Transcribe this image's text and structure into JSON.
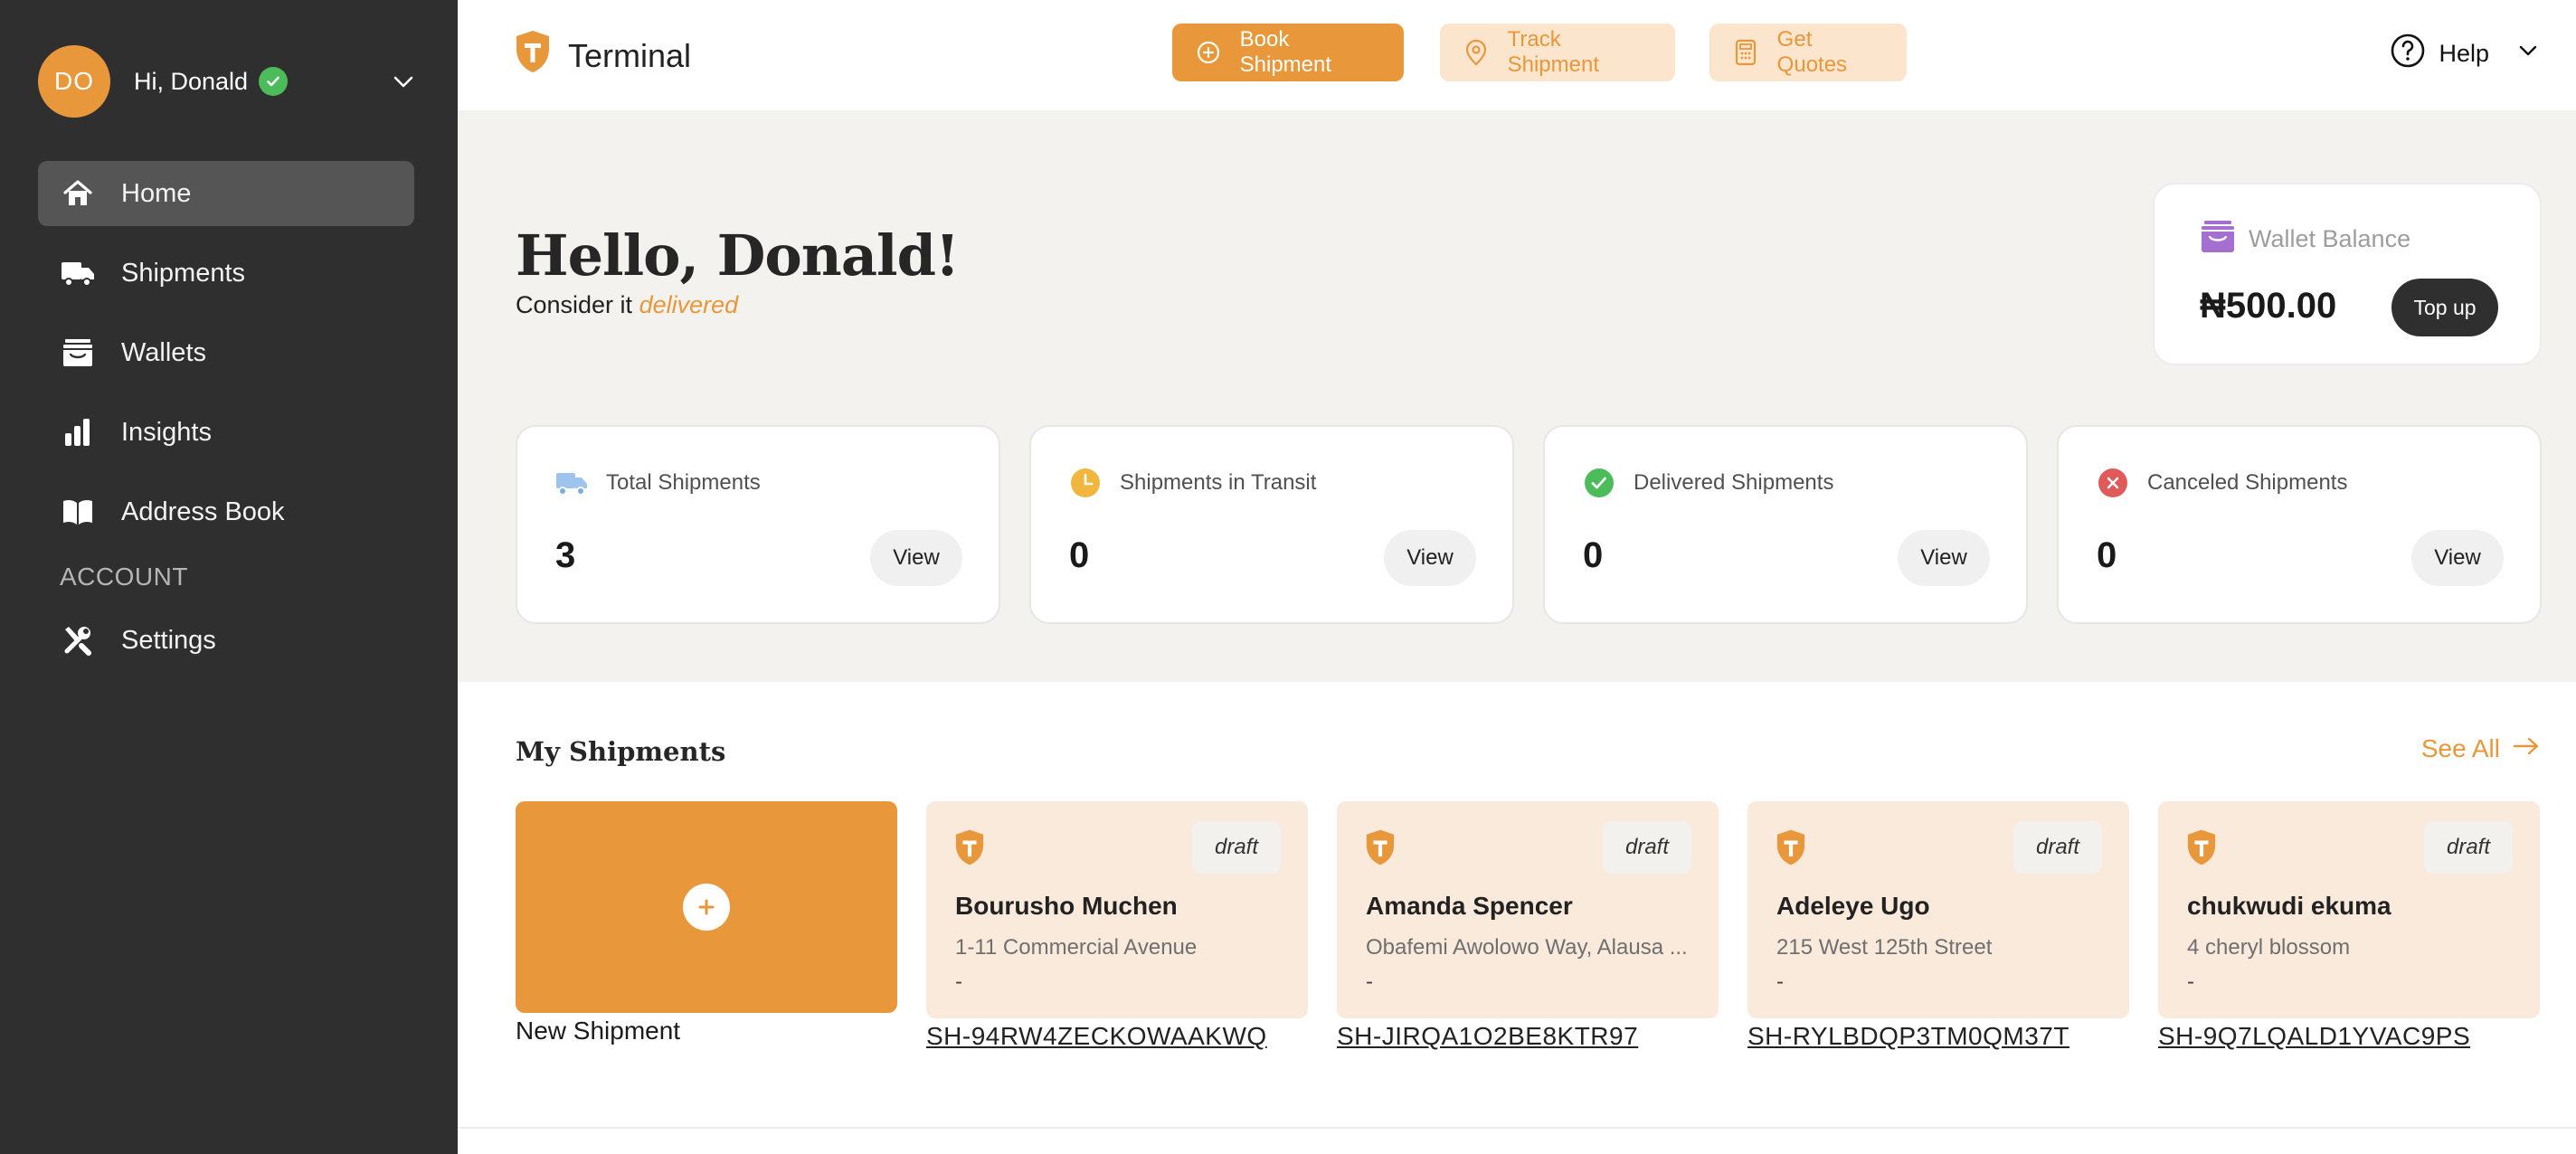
{
  "user": {
    "initials": "DO",
    "greeting": "Hi, Donald"
  },
  "nav": {
    "items": [
      {
        "label": "Home",
        "icon": "home-icon",
        "active": true
      },
      {
        "label": "Shipments",
        "icon": "truck-icon"
      },
      {
        "label": "Wallets",
        "icon": "wallet-icon"
      },
      {
        "label": "Insights",
        "icon": "bar-chart-icon"
      },
      {
        "label": "Address Book",
        "icon": "book-icon"
      }
    ],
    "section_label": "ACCOUNT",
    "settings_label": "Settings"
  },
  "topbar": {
    "brand": "Terminal",
    "book_label": "Book Shipment",
    "track_label": "Track Shipment",
    "quotes_label": "Get Quotes",
    "help_label": "Help"
  },
  "hero": {
    "title": "Hello, Donald!",
    "tagline_prefix": "Consider it ",
    "tagline_emphasis": "delivered"
  },
  "wallet": {
    "label": "Wallet Balance",
    "amount": "₦500.00",
    "topup_label": "Top up"
  },
  "stats": [
    {
      "label": "Total Shipments",
      "value": "3",
      "view": "View",
      "icon": "truck-icon"
    },
    {
      "label": "Shipments in Transit",
      "value": "0",
      "view": "View",
      "icon": "clock-icon"
    },
    {
      "label": "Delivered Shipments",
      "value": "0",
      "view": "View",
      "icon": "check-circle-icon"
    },
    {
      "label": "Canceled Shipments",
      "value": "0",
      "view": "View",
      "icon": "x-circle-icon"
    }
  ],
  "shipments": {
    "title": "My Shipments",
    "see_all": "See All",
    "new_label": "New Shipment",
    "items": [
      {
        "status": "draft",
        "name": "Bourusho Muchen",
        "address": "1-11 Commercial Avenue",
        "detail": "-",
        "id": "SH-94RW4ZECKOWAAKWQ"
      },
      {
        "status": "draft",
        "name": "Amanda Spencer",
        "address": "Obafemi Awolowo Way, Alausa ...",
        "detail": "-",
        "id": "SH-JIRQA1O2BE8KTR97"
      },
      {
        "status": "draft",
        "name": "Adeleye Ugo",
        "address": "215 West 125th Street",
        "detail": "-",
        "id": "SH-RYLBDQP3TM0QM37T"
      },
      {
        "status": "draft",
        "name": "chukwudi ekuma",
        "address": "4 cheryl blossom",
        "detail": "-",
        "id": "SH-9Q7LQALD1YVAC9PS"
      }
    ]
  },
  "colors": {
    "accent": "#e8973a",
    "accent_light": "#fbe6cd",
    "sidebar": "#2f2f2f",
    "success": "#4cbb5a",
    "danger": "#e05a5a"
  }
}
